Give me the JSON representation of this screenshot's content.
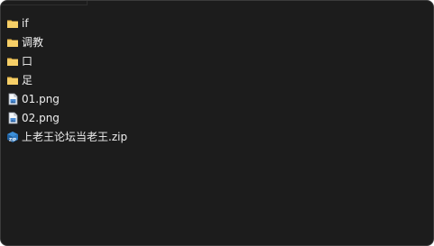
{
  "files": [
    {
      "name": "if",
      "type": "folder"
    },
    {
      "name": "调教",
      "type": "folder"
    },
    {
      "name": "口",
      "type": "folder"
    },
    {
      "name": "足",
      "type": "folder"
    },
    {
      "name": "01.png",
      "type": "png-image"
    },
    {
      "name": "02.png",
      "type": "png-image"
    },
    {
      "name": "上老王论坛当老王.zip",
      "type": "zip-archive"
    }
  ],
  "icons": {
    "folder": "folder-icon",
    "png": "image-file-icon",
    "zip": "zip-file-icon"
  },
  "colors": {
    "background": "#1c1c1c",
    "text": "#eeeeee",
    "folder": "#f2c85a",
    "zip": "#2b78c2"
  }
}
